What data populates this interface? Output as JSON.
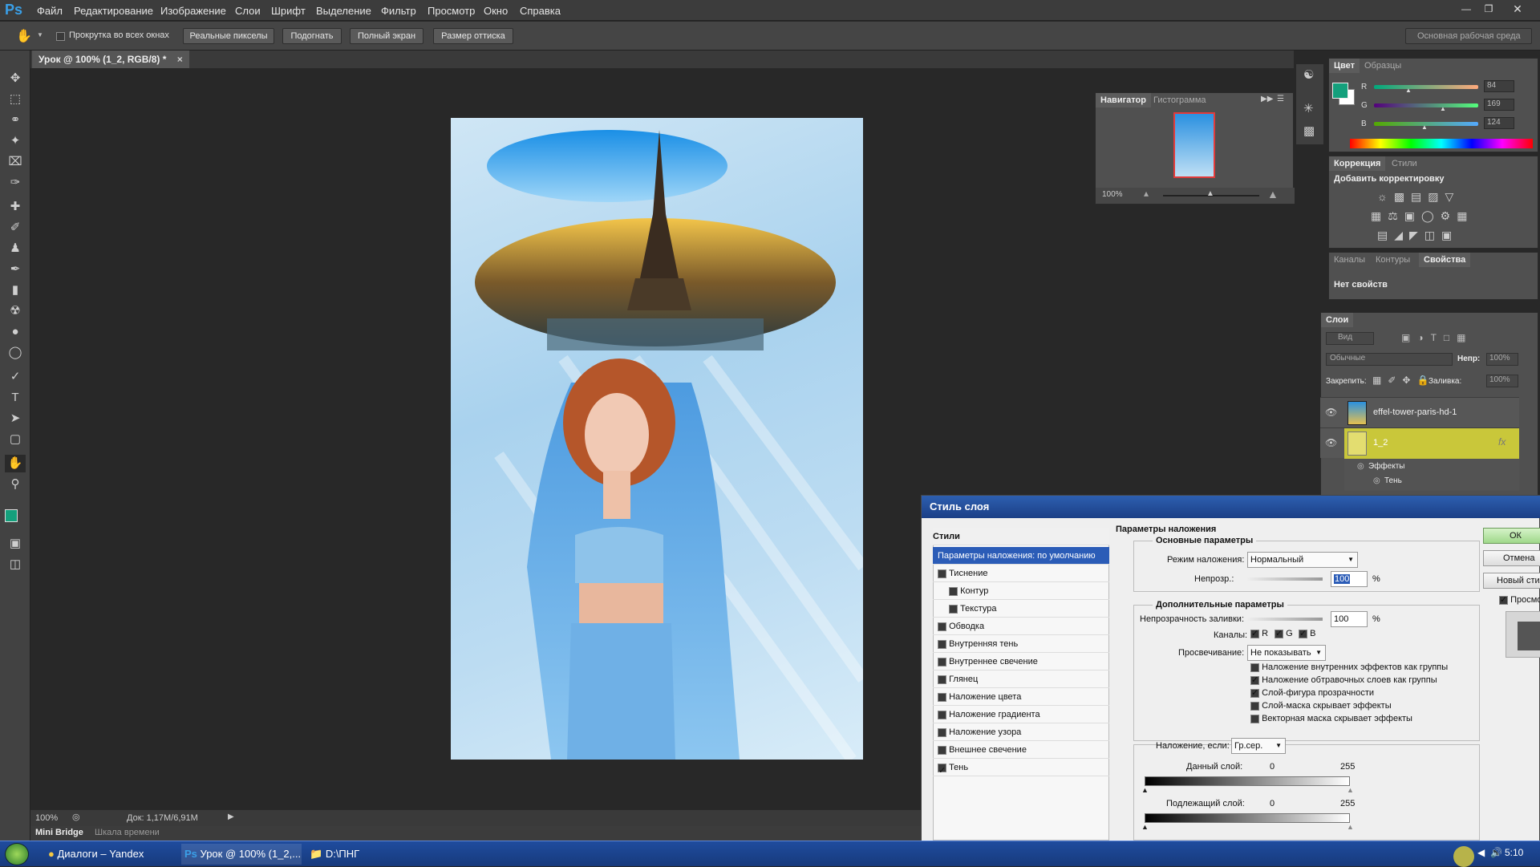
{
  "app": {
    "logo": "Ps"
  },
  "menu": [
    "Файл",
    "Редактирование",
    "Изображение",
    "Слои",
    "Шрифт",
    "Выделение",
    "Фильтр",
    "Просмотр",
    "Окно",
    "Справка"
  ],
  "options": {
    "scroll_all": "Прокрутка во всех окнах",
    "actual_pixels": "Реальные пикселы",
    "fit": "Подогнать",
    "fullscreen": "Полный экран",
    "print_size": "Размер оттиска",
    "workspace": "Основная рабочая среда"
  },
  "document": {
    "tab_title": "Урок @ 100% (1_2, RGB/8) *",
    "zoom": "100%",
    "doc_size": "Док: 1,17M/6,91M"
  },
  "bottom_tabs": [
    "Mini Bridge",
    "Шкала времени"
  ],
  "navigator": {
    "tabs": [
      "Навигатор",
      "Гистограмма"
    ],
    "zoom": "100%"
  },
  "color": {
    "tabs": [
      "Цвет",
      "Образцы"
    ],
    "r_label": "R",
    "g_label": "G",
    "b_label": "B",
    "r": "84",
    "g": "169",
    "b": "124",
    "r_value": 84,
    "g_value": 169,
    "b_value": 124,
    "fg": "#14a07c",
    "bg": "#ffffff"
  },
  "adjustments": {
    "tabs": [
      "Коррекция",
      "Стили"
    ],
    "title": "Добавить корректировку"
  },
  "properties": {
    "tabs": [
      "Каналы",
      "Контуры",
      "Свойства"
    ],
    "text": "Нет свойств"
  },
  "layers": {
    "title": "Слои",
    "filter": "Вид",
    "blend": "Обычные",
    "opacity_label": "Непр:",
    "opacity": "100%",
    "lock_label": "Закрепить:",
    "fill_label": "Заливка:",
    "fill": "100%",
    "items": [
      {
        "name": "effel-tower-paris-hd-1"
      },
      {
        "name": "1_2",
        "fx": "fx"
      }
    ],
    "effects_label": "Эффекты",
    "shadow_label": "Тень"
  },
  "dialog": {
    "title": "Стиль слоя",
    "styles_header": "Стили",
    "styles": [
      {
        "label": "Параметры наложения: по умолчанию",
        "active": true,
        "check": false
      },
      {
        "label": "Тиснение",
        "check": true,
        "on": false
      },
      {
        "label": "Контур",
        "check": true,
        "on": false,
        "indent": true
      },
      {
        "label": "Текстура",
        "check": true,
        "on": false,
        "indent": true
      },
      {
        "label": "Обводка",
        "check": true,
        "on": false
      },
      {
        "label": "Внутренняя тень",
        "check": true,
        "on": false
      },
      {
        "label": "Внутреннее свечение",
        "check": true,
        "on": false
      },
      {
        "label": "Глянец",
        "check": true,
        "on": false
      },
      {
        "label": "Наложение цвета",
        "check": true,
        "on": false
      },
      {
        "label": "Наложение градиента",
        "check": true,
        "on": false
      },
      {
        "label": "Наложение узора",
        "check": true,
        "on": false
      },
      {
        "label": "Внешнее свечение",
        "check": true,
        "on": false
      },
      {
        "label": "Тень",
        "check": true,
        "on": true
      }
    ],
    "blend_header": "Параметры наложения",
    "general_header": "Основные параметры",
    "blend_mode_label": "Режим наложения:",
    "blend_mode": "Нормальный",
    "opacity_label": "Непрозр.:",
    "opacity": "100",
    "pct": "%",
    "advanced_header": "Дополнительные параметры",
    "fill_label": "Непрозрачность заливки:",
    "fill": "100",
    "channels_label": "Каналы:",
    "channels": [
      "R",
      "G",
      "B"
    ],
    "knockout_label": "Просвечивание:",
    "knockout": "Не показывать",
    "options": [
      {
        "label": "Наложение внутренних эффектов как группы",
        "on": false
      },
      {
        "label": "Наложение обтравочных слоев как группы",
        "on": true
      },
      {
        "label": "Слой-фигура прозрачности",
        "on": true
      },
      {
        "label": "Слой-маска скрывает эффекты",
        "on": false
      },
      {
        "label": "Векторная маска скрывает эффекты",
        "on": false
      }
    ],
    "blend_if_label": "Наложение, если:",
    "blend_if": "Гр.сер.",
    "this_layer": "Данный слой:",
    "underlying": "Подлежащий слой:",
    "min": "0",
    "max": "255",
    "ok": "ОК",
    "cancel": "Отмена",
    "new_style": "Новый стиль...",
    "preview": "Просмотр"
  },
  "taskbar": {
    "items": [
      "Диалоги – Yandex",
      "Урок @ 100% (1_2,...",
      "D:\\ПНГ"
    ],
    "time": "5:10"
  }
}
